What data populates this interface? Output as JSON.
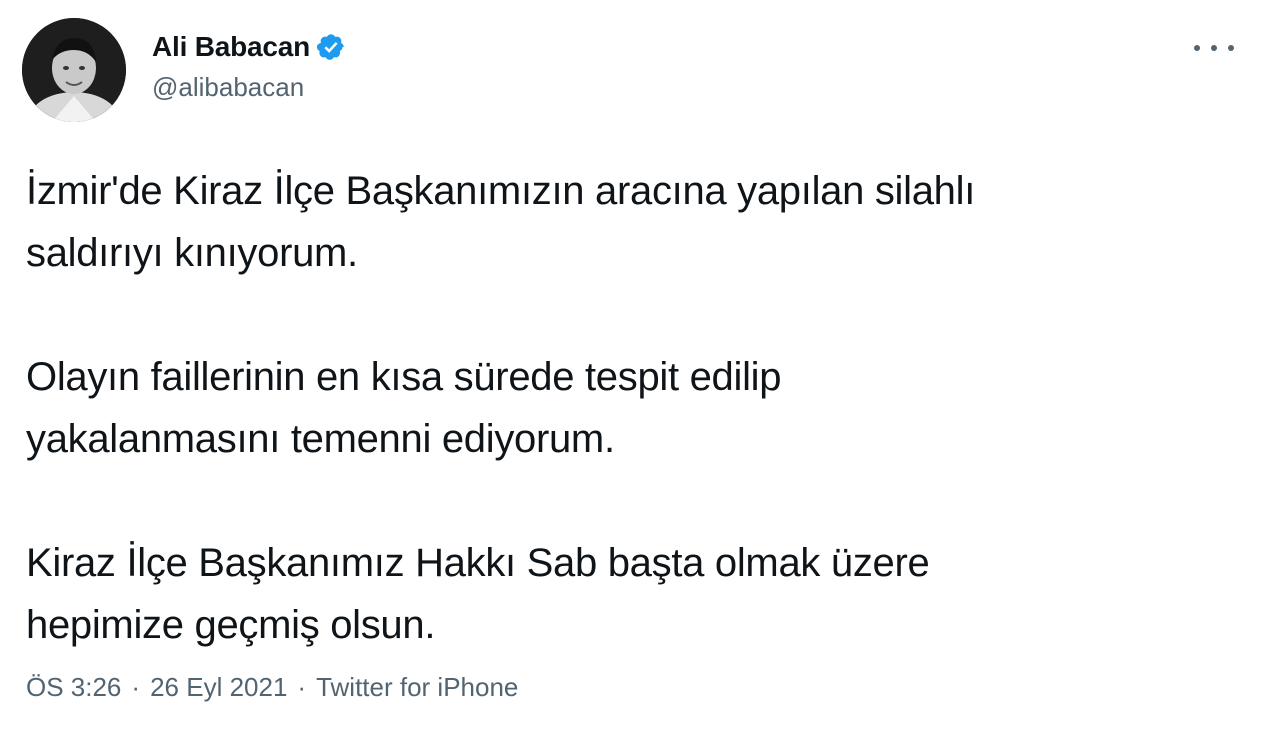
{
  "author": {
    "display_name": "Ali Babacan",
    "handle": "@alibabacan",
    "verified_icon": "verified-badge-icon",
    "verified_color": "#1d9bf0"
  },
  "menu": {
    "icon": "more-options-icon"
  },
  "tweet": {
    "paragraphs": [
      {
        "lines": [
          "İzmir'de Kiraz İlçe Başkanımızın aracına yapılan silahlı",
          "saldırıyı kınıyorum."
        ]
      },
      {
        "lines": [
          "Olayın faillerinin en kısa sürede tespit edilip",
          "yakalanmasını temenni ediyorum."
        ]
      },
      {
        "lines": [
          "Kiraz İlçe Başkanımız Hakkı Sab başta olmak üzere",
          "hepimize geçmiş olsun."
        ]
      }
    ]
  },
  "meta": {
    "time": "ÖS 3:26",
    "separator": "·",
    "date": "26 Eyl 2021",
    "source": "Twitter for iPhone"
  },
  "colors": {
    "text": "#0f1419",
    "secondary": "#536471",
    "accent": "#1d9bf0"
  }
}
